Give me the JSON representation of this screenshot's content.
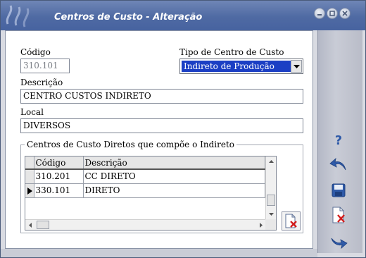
{
  "window": {
    "title": "Centros de Custo - Alteração"
  },
  "form": {
    "codigo_label": "Código",
    "codigo_value": "310.101",
    "tipo_label": "Tipo de Centro de Custo",
    "tipo_value": "Indireto de Produção",
    "descricao_label": "Descrição",
    "descricao_value": "CENTRO CUSTOS INDIRETO",
    "local_label": "Local",
    "local_value": "DIVERSOS"
  },
  "group": {
    "title": "Centros de Custo Diretos que compõe o Indireto",
    "columns": [
      "Código",
      "Descrição"
    ],
    "rows": [
      {
        "codigo": "310.201",
        "descricao": "CC DIRETO"
      },
      {
        "codigo": "330.101",
        "descricao": "DIRETO"
      }
    ],
    "current_row": 2
  },
  "icons": {
    "logo": "app-logo-icon",
    "minimize": "minimize-icon",
    "restore": "restore-icon",
    "close": "close-icon",
    "help": "help-icon",
    "undo": "undo-icon",
    "save": "save-icon",
    "delete": "delete-document-icon",
    "redo": "redo-icon"
  },
  "colors": {
    "titlebar": "#4f6aa3",
    "selection": "#1b3fc4",
    "accent_blue": "#2f5aa8",
    "delete_red": "#d21c1c"
  }
}
